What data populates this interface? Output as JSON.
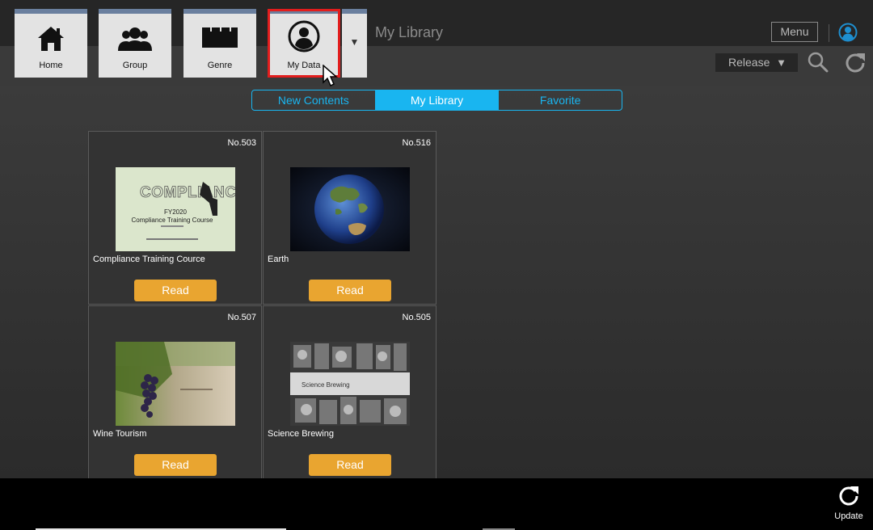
{
  "nav": {
    "tiles": [
      {
        "label": "Home",
        "icon": "home-icon"
      },
      {
        "label": "Group",
        "icon": "group-icon"
      },
      {
        "label": "Genre",
        "icon": "genre-icon"
      },
      {
        "label": "My Data",
        "icon": "person-icon",
        "selected": true
      }
    ],
    "dropdown_glyph": "▼"
  },
  "header": {
    "title": "My Library",
    "menu_label": "Menu"
  },
  "toolbar": {
    "filter_value": "Release",
    "filter_arrow": "▼"
  },
  "segments": [
    {
      "label": "New Contents",
      "active": false
    },
    {
      "label": "My Library",
      "active": true
    },
    {
      "label": "Favorite",
      "active": false
    }
  ],
  "cards": [
    {
      "number": "No.503",
      "title": "Compliance Training Cource",
      "button": "Read",
      "thumb": {
        "heading": "COMPLIANCE",
        "line1": "FY2020",
        "line2": "Compliance Training Course"
      }
    },
    {
      "number": "No.516",
      "title": "Earth",
      "button": "Read"
    },
    {
      "number": "No.507",
      "title": "Wine Tourism",
      "button": "Read"
    },
    {
      "number": "No.505",
      "title": "Science Brewing",
      "button": "Read",
      "thumb": {
        "banner": "Science Brewing"
      }
    }
  ],
  "footer": {
    "update_label": "Update"
  },
  "colors": {
    "accent": "#19b5f0",
    "read_button": "#e9a530",
    "selected_outline": "#e21d1d"
  }
}
